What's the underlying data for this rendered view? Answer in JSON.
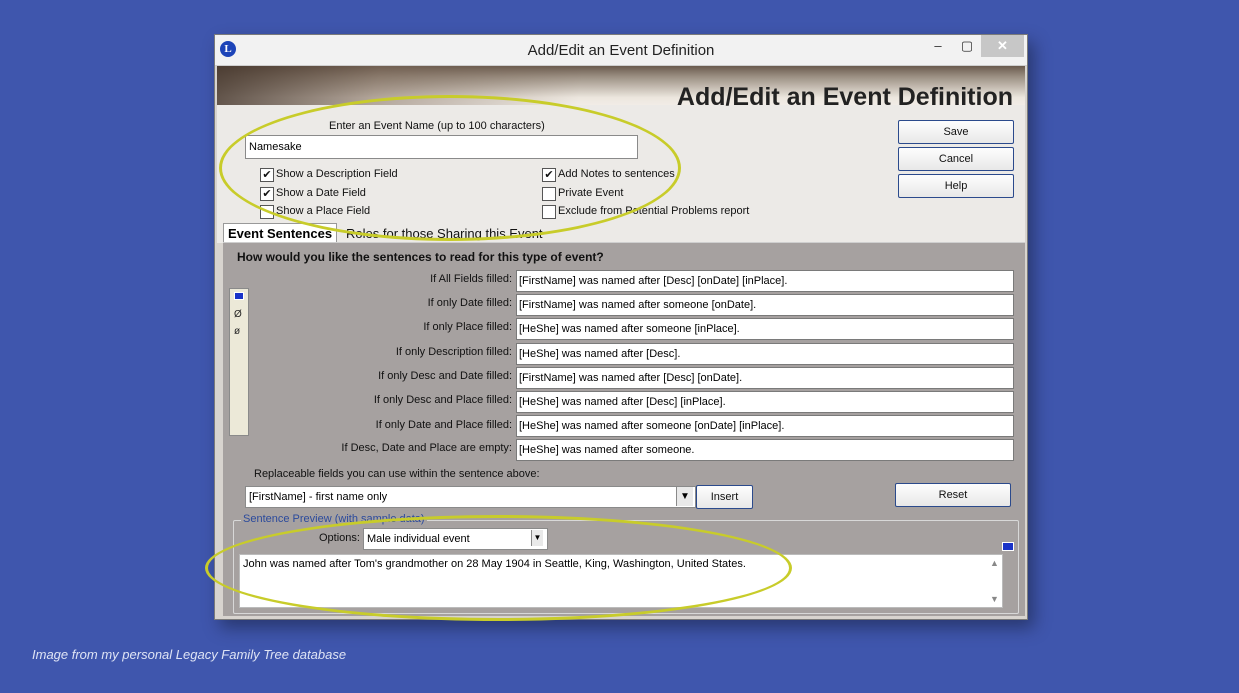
{
  "window": {
    "title": "Add/Edit an Event Definition",
    "min_glyph": "–",
    "max_glyph": "▢",
    "close_glyph": "✕",
    "app_icon_letter": "L"
  },
  "header": {
    "big_title": "Add/Edit an Event Definition",
    "name_label": "Enter an Event Name (up to 100 characters)",
    "name_value": "Namesake"
  },
  "checkboxes": [
    {
      "label": "Show a Description Field",
      "checked": true
    },
    {
      "label": "Show a Date Field",
      "checked": true
    },
    {
      "label": "Show a Place Field",
      "checked": false
    },
    {
      "label": "Add Notes to sentences",
      "checked": true
    },
    {
      "label": "Private Event",
      "checked": false
    },
    {
      "label": "Exclude from Potential Problems report",
      "checked": false
    }
  ],
  "buttons": {
    "save": "Save",
    "cancel": "Cancel",
    "help": "Help",
    "insert": "Insert",
    "reset": "Reset"
  },
  "tabs": {
    "active": "Event Sentences",
    "other": "Roles for those Sharing this Event"
  },
  "sentences": {
    "question": "How would you like the sentences to read for this type of event?",
    "rows": [
      {
        "label": "If All Fields filled:",
        "value": "[FirstName] was named after [Desc] [onDate] [inPlace]."
      },
      {
        "label": "If only Date filled:",
        "value": "[FirstName] was named after someone [onDate]."
      },
      {
        "label": "If only Place filled:",
        "value": "[HeShe] was named after someone [inPlace]."
      },
      {
        "label": "If only Description filled:",
        "value": "[HeShe] was named after [Desc]."
      },
      {
        "label": "If only Desc and Date filled:",
        "value": "[FirstName] was named after [Desc] [onDate]."
      },
      {
        "label": "If only Desc and Place filled:",
        "value": "[HeShe] was named after [Desc] [inPlace]."
      },
      {
        "label": "If only Date and Place filled:",
        "value": "[HeShe] was named after someone [onDate] [inPlace]."
      },
      {
        "label": "If Desc, Date and Place are empty:",
        "value": "[HeShe] was named after someone."
      }
    ],
    "side_symbols": [
      "Ø",
      "ø"
    ]
  },
  "replaceable": {
    "label": "Replaceable fields you can use within the sentence above:",
    "selected": "[FirstName] - first name only"
  },
  "preview": {
    "legend": "Sentence Preview (with sample data)",
    "options_label": "Options:",
    "options_value": "Male individual event",
    "text": "John was named after Tom's grandmother on 28 May 1904 in Seattle, King, Washington, United States."
  },
  "caption": "Image from my personal Legacy Family Tree database",
  "colors": {
    "background": "#3f56ad",
    "highlight_ellipse": "#c8cc2a"
  }
}
